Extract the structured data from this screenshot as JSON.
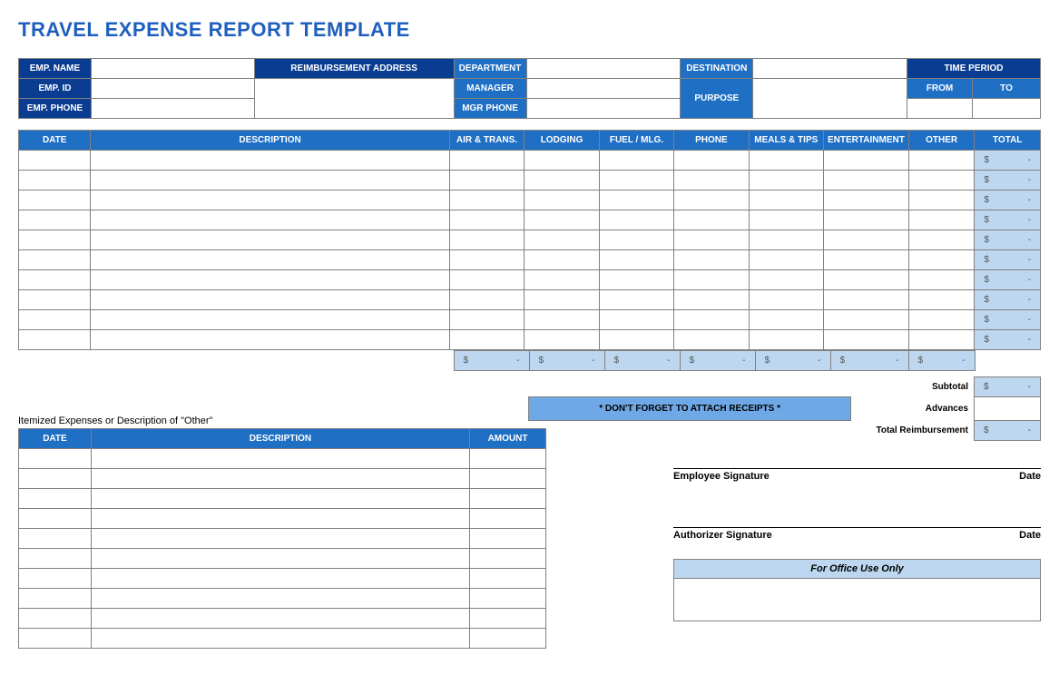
{
  "title": "TRAVEL EXPENSE REPORT TEMPLATE",
  "info": {
    "emp_name": "EMP. NAME",
    "emp_id": "EMP. ID",
    "emp_phone": "EMP. PHONE",
    "reimb_addr": "REIMBURSEMENT ADDRESS",
    "department": "DEPARTMENT",
    "manager": "MANAGER",
    "mgr_phone": "MGR PHONE",
    "destination": "DESTINATION",
    "purpose": "PURPOSE",
    "time_period": "TIME PERIOD",
    "from": "FROM",
    "to": "TO"
  },
  "cols": {
    "date": "DATE",
    "desc": "DESCRIPTION",
    "air": "AIR & TRANS.",
    "lodging": "LODGING",
    "fuel": "FUEL / MLG.",
    "phone": "PHONE",
    "meals": "MEALS & TIPS",
    "ent": "ENTERTAINMENT",
    "other": "OTHER",
    "total": "TOTAL",
    "amount": "AMOUNT"
  },
  "money": {
    "sym": "$",
    "dash": "-"
  },
  "summary": {
    "subtotal": "Subtotal",
    "advances": "Advances",
    "total_reimb": "Total Reimbursement"
  },
  "receipts_msg": "* DON'T FORGET TO ATTACH RECEIPTS *",
  "itemized_caption": "Itemized Expenses or Description of \"Other\"",
  "sig": {
    "emp": "Employee Signature",
    "auth": "Authorizer Signature",
    "date": "Date"
  },
  "office": "For Office Use Only"
}
